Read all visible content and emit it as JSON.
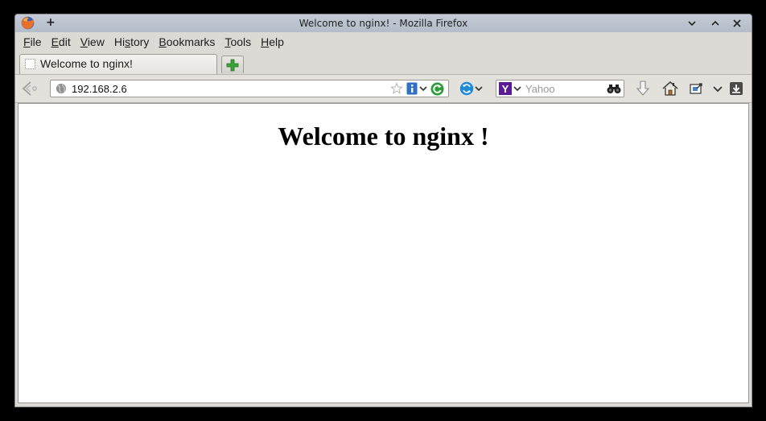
{
  "window": {
    "title": "Welcome to nginx! - Mozilla Firefox",
    "new_window_symbol": "+"
  },
  "menu": {
    "items": [
      {
        "label": "File",
        "accel": "F"
      },
      {
        "label": "Edit",
        "accel": "E"
      },
      {
        "label": "View",
        "accel": "V"
      },
      {
        "label": "History",
        "accel": "s"
      },
      {
        "label": "Bookmarks",
        "accel": "B"
      },
      {
        "label": "Tools",
        "accel": "T"
      },
      {
        "label": "Help",
        "accel": "H"
      }
    ]
  },
  "tabs": [
    {
      "label": "Welcome to nginx!",
      "active": true
    }
  ],
  "navbar": {
    "url": "192.168.2.6",
    "search_placeholder": "Yahoo",
    "search_engine_letter": "Y"
  },
  "icons": {
    "browser": "firefox-logo-icon",
    "back": "back-arrow-icon",
    "site": "globe-icon",
    "bookmark": "star-icon",
    "info": "info-icon",
    "reload": "reload-icon",
    "sync": "sync-icon",
    "search": "binoculars-icon",
    "downloads": "download-arrow-icon",
    "home": "home-icon",
    "screenshot": "screenshot-icon",
    "menu": "chevron-down-icon",
    "save": "save-download-icon"
  },
  "page": {
    "heading": "Welcome to nginx !"
  },
  "colors": {
    "titlebar": "#b8c0cc",
    "chrome": "#dcdad5",
    "yahoo_purple": "#5c1b96",
    "reload_green": "#2c9b3a",
    "sync_blue": "#1f8ad6",
    "newtab_green": "#3aa33a"
  }
}
